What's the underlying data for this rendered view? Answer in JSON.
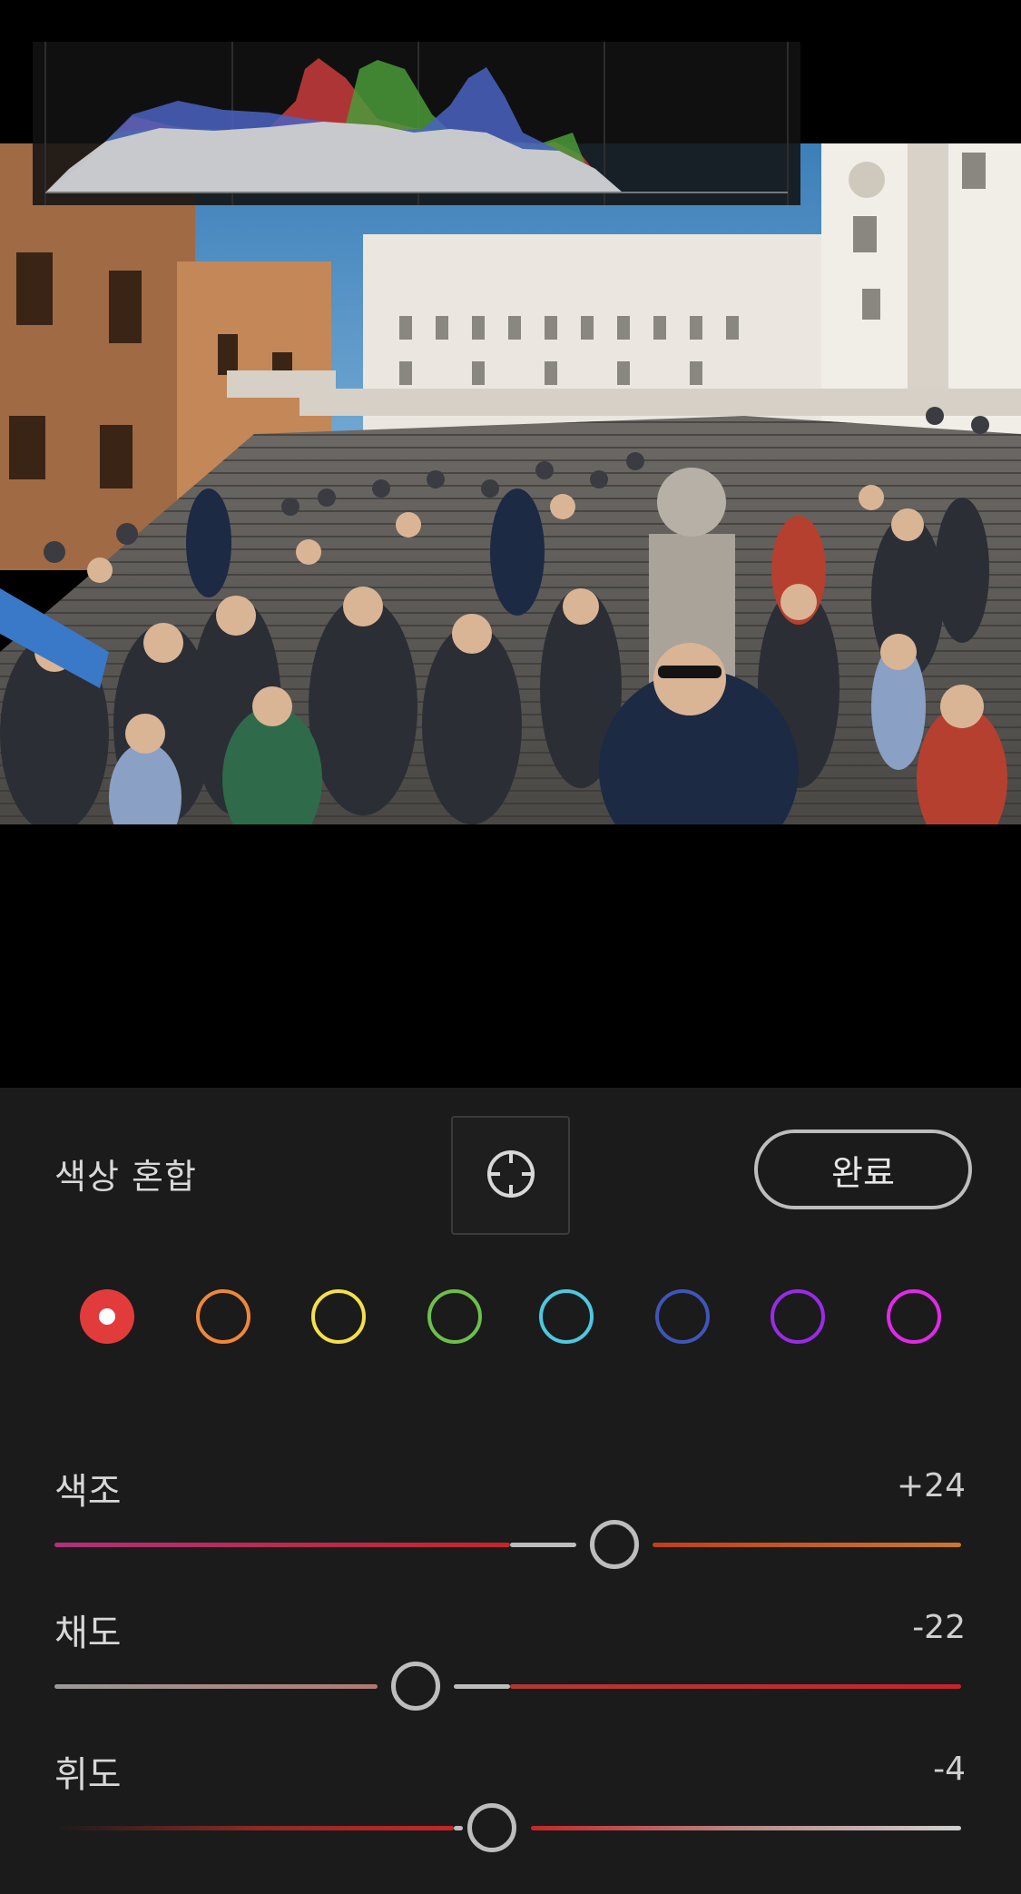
{
  "panel": {
    "title": "색상 혼합",
    "done_label": "완료",
    "target_tool_icon": "target-adjust-icon"
  },
  "histogram": {
    "visible": true,
    "channels": [
      "red",
      "green",
      "blue",
      "luminance"
    ]
  },
  "photo": {
    "subject": "spanish-steps-crowd-photo"
  },
  "color_swatches": [
    {
      "name": "red",
      "color": "#e23b3b",
      "selected": true
    },
    {
      "name": "orange",
      "color": "#f0873a",
      "selected": false
    },
    {
      "name": "yellow",
      "color": "#f4e04a",
      "selected": false
    },
    {
      "name": "green",
      "color": "#6cc04a",
      "selected": false
    },
    {
      "name": "aqua",
      "color": "#4ec7e0",
      "selected": false
    },
    {
      "name": "blue",
      "color": "#3f56b8",
      "selected": false
    },
    {
      "name": "purple",
      "color": "#9a2be6",
      "selected": false
    },
    {
      "name": "magenta",
      "color": "#e02ae8",
      "selected": false
    }
  ],
  "sliders": {
    "hue": {
      "label": "색조",
      "value": "+24",
      "numeric": 24,
      "min": -100,
      "max": 100
    },
    "saturation": {
      "label": "채도",
      "value": "-22",
      "numeric": -22,
      "min": -100,
      "max": 100
    },
    "luminance": {
      "label": "휘도",
      "value": "-4",
      "numeric": -4,
      "min": -100,
      "max": 100
    }
  }
}
